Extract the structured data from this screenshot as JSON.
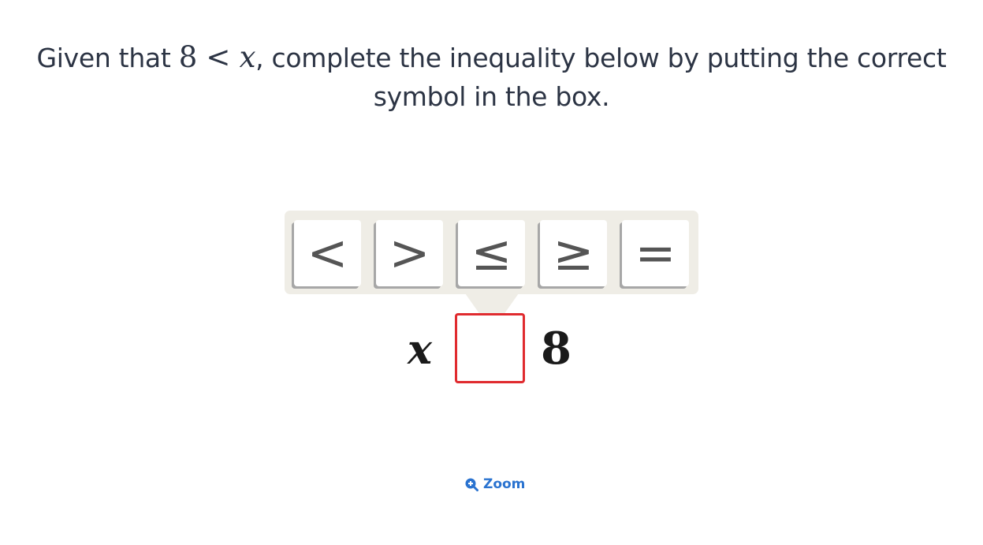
{
  "question": {
    "prefix": "Given that ",
    "math_left": "8",
    "math_op": "<",
    "math_right": "x",
    "suffix": ", complete the inequality below by putting the correct",
    "line2": "symbol in the box."
  },
  "palette": {
    "keys": [
      "<",
      ">",
      "≤",
      "≥",
      "="
    ]
  },
  "equation": {
    "left": "x",
    "box_value": "",
    "right": "8"
  },
  "zoom": {
    "label": "Zoom",
    "icon": "zoom-in-icon"
  },
  "colors": {
    "text": "#2c3444",
    "palette_bg": "#efede6",
    "box_border": "#e02b2f",
    "link": "#2a73d0"
  }
}
